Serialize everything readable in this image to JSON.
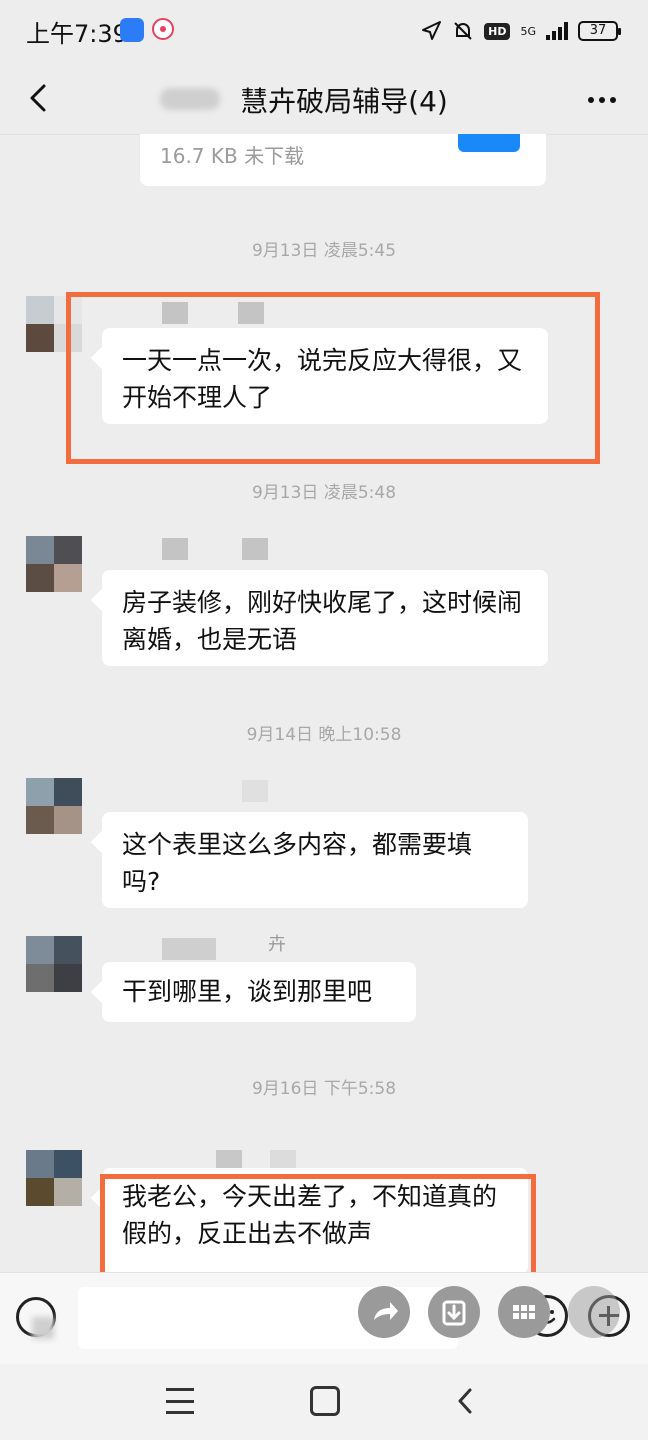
{
  "status_bar": {
    "time": "上午7:39",
    "hd": "HD",
    "network": "5G",
    "battery": "37"
  },
  "header": {
    "title": "慧卉破局辅导(4)"
  },
  "file_message": {
    "meta": "16.7 KB  未下载"
  },
  "messages": [
    {
      "timestamp": "9月13日 凌晨5:45",
      "text": "一天一点一次，说完反应大得很，又开始不理人了",
      "highlighted": true
    },
    {
      "timestamp": "9月13日 凌晨5:48",
      "text": "房子装修，刚好快收尾了，这时候闹离婚，也是无语",
      "highlighted": false
    },
    {
      "timestamp": "9月14日 晚上10:58",
      "text": "这个表里这么多内容，都需要填吗?",
      "highlighted": false
    },
    {
      "timestamp": "",
      "text": "干到哪里，谈到那里吧",
      "highlighted": false
    },
    {
      "timestamp": "9月16日 下午5:58",
      "text": "我老公，今天出差了，不知道真的假的，反正出去不做声",
      "highlighted": true
    }
  ],
  "visible_name_fragments": [
    "卉"
  ],
  "colors": {
    "background": "#ededed",
    "bubble": "#ffffff",
    "highlight": "#f36c3d",
    "timestamp": "#a8a8a8"
  },
  "icons": {
    "back": "chevron-left-icon",
    "more": "more-dots-icon",
    "voice": "voice-icon",
    "emoji": "emoji-icon",
    "plus": "plus-icon",
    "nav_menu": "menu-icon",
    "nav_home": "home-icon",
    "nav_back": "back-triangle-icon"
  }
}
